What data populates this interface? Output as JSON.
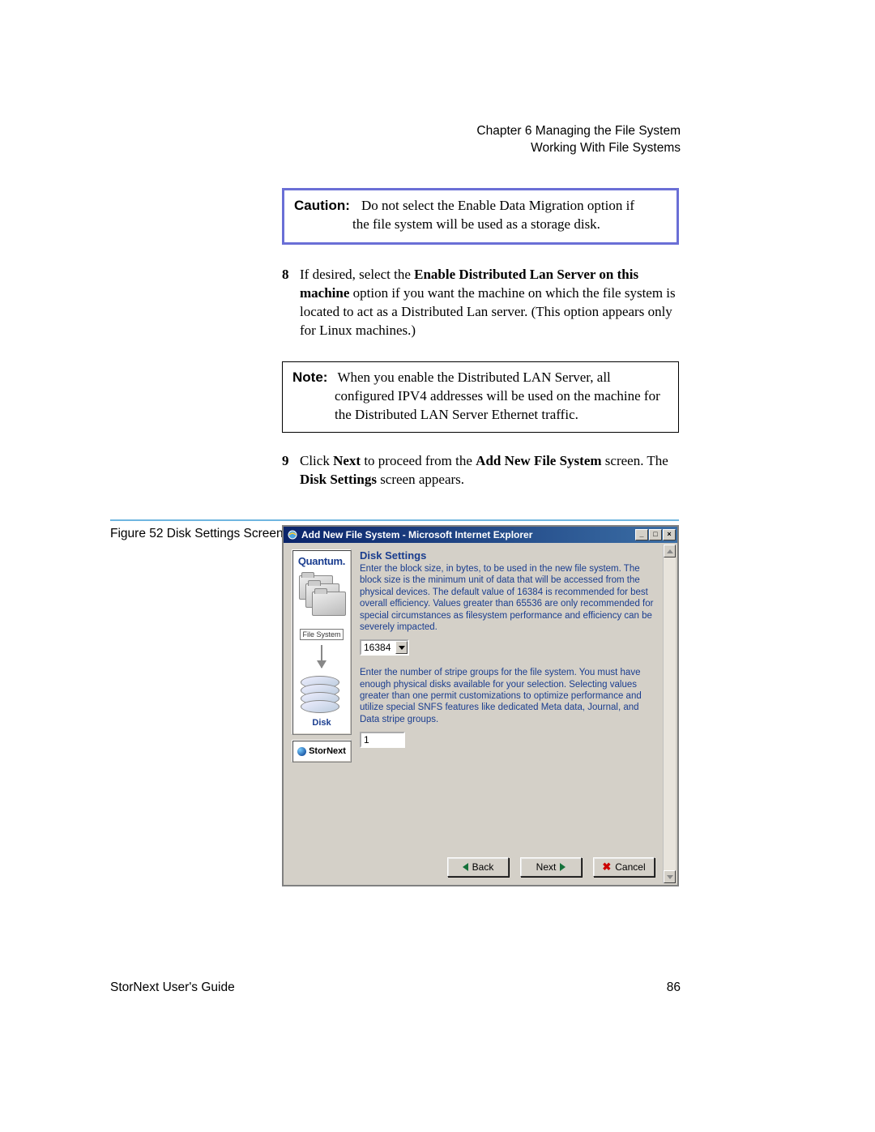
{
  "header": {
    "chapter": "Chapter 6  Managing the File System",
    "section": "Working With File Systems"
  },
  "caution": {
    "label": "Caution:",
    "line1_after_label": "Do not select the Enable Data Migration option if",
    "line2": "the file system will be used as a storage disk."
  },
  "step8": {
    "num": "8",
    "pre": "If desired, select the ",
    "bold": "Enable Distributed Lan Server on this machine",
    "post": " option if you want the machine on which the file system is located to act as a Distributed Lan server. (This option appears only for Linux machines.)"
  },
  "note": {
    "label": "Note:",
    "line1_after_label": "When you enable the Distributed LAN Server, all",
    "line2": "configured IPV4 addresses will be used on the machine for the Distributed LAN Server Ethernet traffic."
  },
  "step9": {
    "num": "9",
    "pre": "Click ",
    "b1": "Next",
    "mid": " to proceed from the ",
    "b2": "Add New File System",
    "post1": " screen. The ",
    "b3": "Disk Settings",
    "post2": " screen appears."
  },
  "figure": {
    "caption": "Figure 52  Disk Settings Screen"
  },
  "dialog": {
    "title": "Add New File System - Microsoft Internet Explorer",
    "brand": "Quantum.",
    "fs_label": "File System",
    "disk_label": "Disk",
    "product": "StorNext",
    "heading": "Disk Settings",
    "para1": "Enter the block size, in bytes, to be used in the new file system. The block size is the minimum unit of data that will be accessed from the physical devices. The default value of 16384 is recommended for best overall efficiency. Values greater than 65536 are only recommended for special circumstances as filesystem performance and efficiency can be severely impacted.",
    "block_size": "16384",
    "para2": "Enter the number of stripe groups for the file system. You must have enough physical disks available for your selection. Selecting values greater than one permit customizations to optimize performance and utilize special SNFS features like dedicated Meta data, Journal, and Data stripe groups.",
    "stripe_groups": "1",
    "buttons": {
      "back": "Back",
      "next": "Next",
      "cancel": "Cancel"
    }
  },
  "footer": {
    "guide": "StorNext User's Guide",
    "page": "86"
  }
}
